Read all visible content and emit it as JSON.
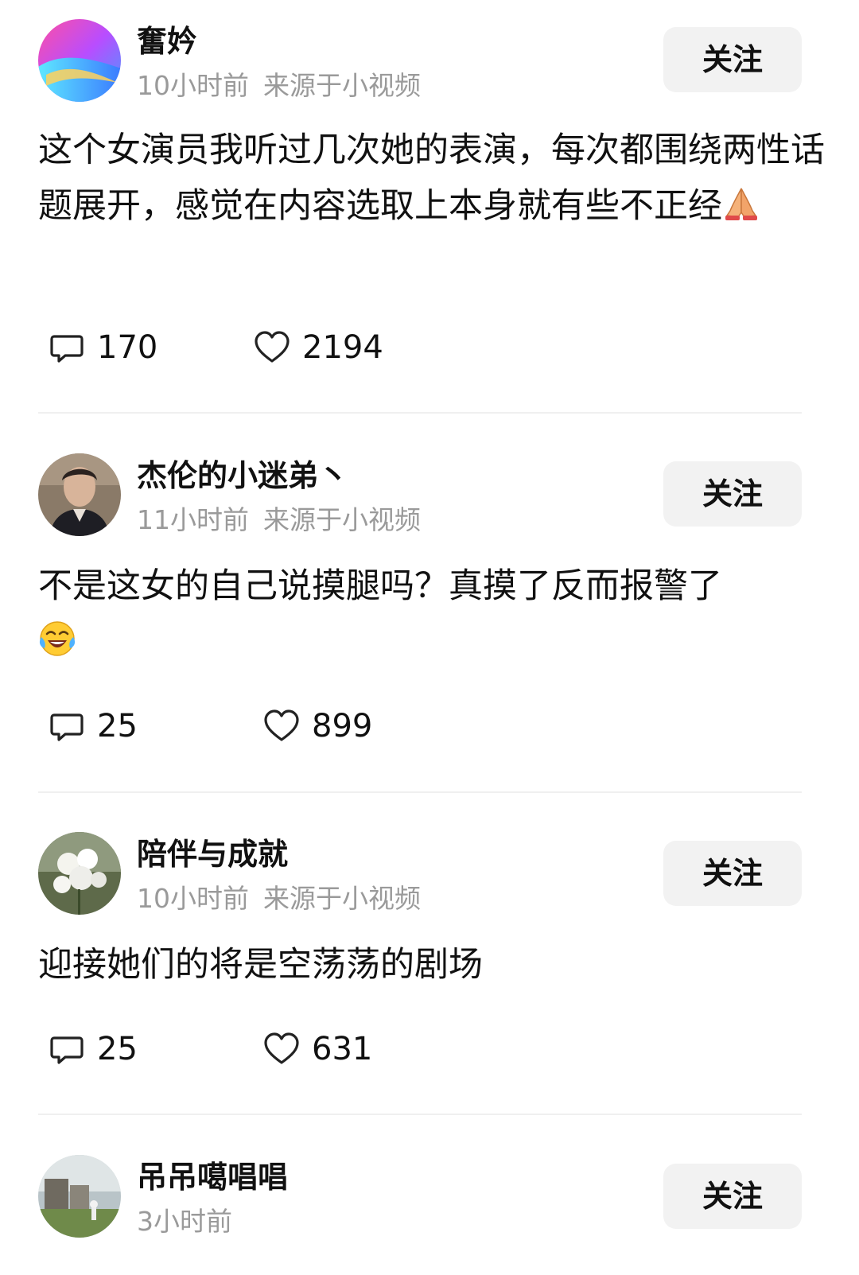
{
  "follow_label": "关注",
  "posts": [
    {
      "username": "奮妗",
      "time": "10小时前",
      "source": "来源于小视频",
      "content": "这个女演员我听过几次她的表演，每次都围绕两性话题展开，感觉在内容选取上本身就有些不正经",
      "content_emoji": "praying-hands",
      "comments": "170",
      "likes": "2194"
    },
    {
      "username": "杰伦的小迷弟丶",
      "time": "11小时前",
      "source": "来源于小视频",
      "content": "不是这女的自己说摸腿吗？真摸了反而报警了",
      "content_emoji": "crying-laughing-face",
      "comments": "25",
      "likes": "899"
    },
    {
      "username": "陪伴与成就",
      "time": "10小时前",
      "source": "来源于小视频",
      "content": "迎接她们的将是空荡荡的剧场",
      "comments": "25",
      "likes": "631"
    },
    {
      "username": "吊吊噶唱唱",
      "time": "3小时前"
    }
  ],
  "icons": {
    "comment": "comment-icon",
    "like": "heart-icon"
  },
  "colors": {
    "meta_text": "#9a9a9a",
    "button_bg": "#f2f2f2",
    "divider": "#f0f0f0"
  }
}
